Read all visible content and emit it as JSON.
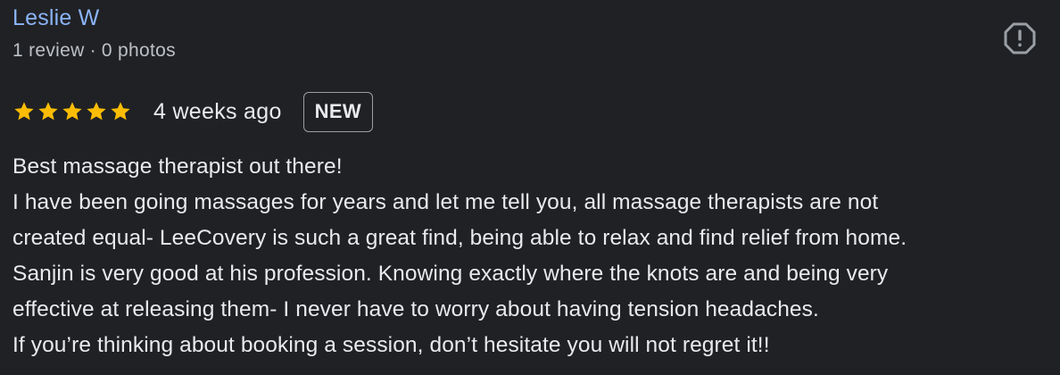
{
  "review": {
    "author": {
      "name": "Leslie W",
      "review_count": "1 review",
      "separator": "·",
      "photo_count": "0 photos"
    },
    "report_icon": "report-flag-icon",
    "rating": {
      "stars": 5,
      "max_stars": 5,
      "star_color": "#fbbc04",
      "time_ago": "4 weeks ago",
      "badge": "NEW"
    },
    "text_lines": [
      "Best massage therapist out there!",
      "I have been going massages for years and let me tell you, all massage therapists are not",
      "created equal- LeeCovery is such a great find, being able to relax and find relief from home.",
      "Sanjin is very good at his profession. Knowing exactly where the knots are and being very",
      "effective at releasing them- I never have to worry about having tension headaches.",
      "If you’re thinking about booking a session, don’t hesitate you will not regret it!!"
    ]
  },
  "colors": {
    "background": "#202124",
    "link": "#8ab4f8",
    "text": "#e8eaed",
    "muted": "#bdc1c6"
  }
}
